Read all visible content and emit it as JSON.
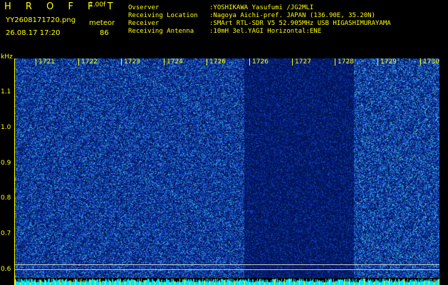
{
  "header": {
    "brand": "H R O F F T",
    "version": "1.00f",
    "filename": "YY2608171720.png",
    "timestamp": "26.08.17 17:20",
    "meteor_label": "meteor",
    "meteor_count": "86"
  },
  "info": [
    {
      "label": "Ovserver",
      "value": ":YOSHIKAWA Yasufumi /JG2MLI"
    },
    {
      "label": "Receiving Location",
      "value": ":Nagoya Aichi-pref. JAPAN (136.90E, 35.20N)"
    },
    {
      "label": "Receiver",
      "value": ":SMArt RTL-SDR V5 52.905MHz USB HIGASHIMURAYAMA"
    },
    {
      "label": "Receiving Antenna",
      "value": ":10mH 3el.YAGI Horizontal:ENE"
    }
  ],
  "axis": {
    "unit": "kHz",
    "y_ticks": [
      "1.1",
      "1.0",
      "0.9",
      "0.8",
      "0.7",
      "0.6"
    ],
    "x_ticks": [
      "1721",
      "1722",
      "1723",
      "1724",
      "1726",
      "1726",
      "1727",
      "1728",
      "1729",
      "1730"
    ]
  },
  "colors": {
    "text": "#ffff00",
    "noise_dark": "#000a5a",
    "noise_mid": "#1e3cc8",
    "noise_hot": "#41c8e6",
    "baseline": "#00e6ff",
    "level_line": "#c8c8c8"
  }
}
